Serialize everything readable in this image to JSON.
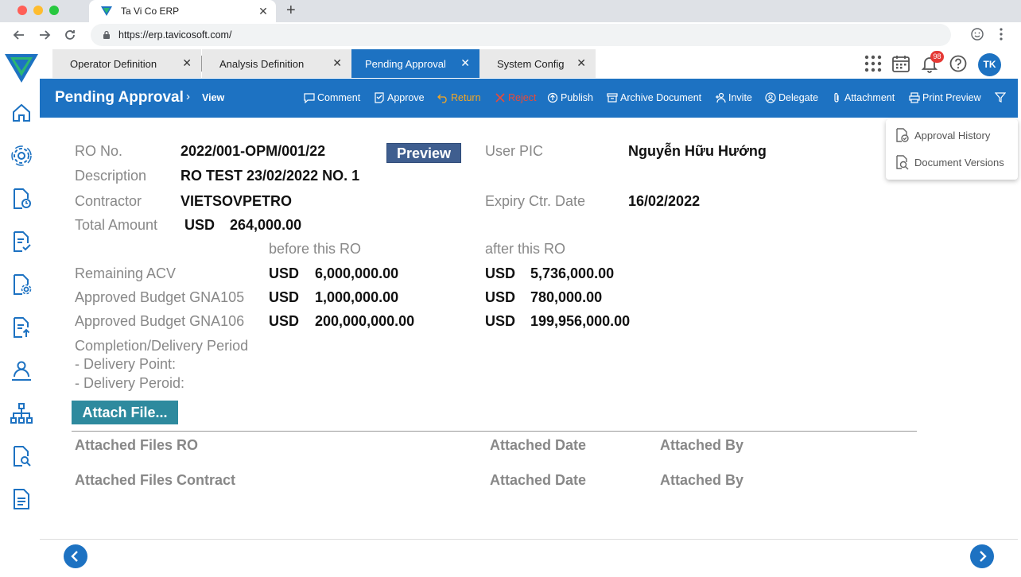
{
  "browser": {
    "tab_title": "Ta Vi Co ERP",
    "url": "https://erp.tavicosoft.com/",
    "new_tab": "+",
    "tab_close": "✕"
  },
  "app_tabs": [
    {
      "label": "Operator Definition",
      "close": "✕"
    },
    {
      "label": "Analysis Definition",
      "close": "✕"
    },
    {
      "label": "Pending Approval",
      "close": "✕"
    },
    {
      "label": "System Config",
      "close": "✕"
    }
  ],
  "header": {
    "notification_count": "98",
    "avatar_initials": "TK"
  },
  "action_bar": {
    "page_title": "Pending Approval",
    "breadcrumb_sep": "›",
    "breadcrumb_current": "View",
    "actions": [
      {
        "label": "Comment",
        "icon": "comment-icon"
      },
      {
        "label": "Approve",
        "icon": "approve-icon"
      },
      {
        "label": "Return",
        "icon": "return-icon"
      },
      {
        "label": "Reject",
        "icon": "reject-icon"
      },
      {
        "label": "Publish",
        "icon": "publish-icon"
      },
      {
        "label": "Archive Document",
        "icon": "archive-icon"
      },
      {
        "label": "Invite",
        "icon": "invite-icon"
      },
      {
        "label": "Delegate",
        "icon": "delegate-icon"
      },
      {
        "label": "Attachment",
        "icon": "paperclip-icon"
      },
      {
        "label": "Print Preview",
        "icon": "print-icon"
      }
    ]
  },
  "dropdown": {
    "items": [
      "Approval History",
      "Document Versions"
    ]
  },
  "form": {
    "ro_no_label": "RO No.",
    "ro_no": "2022/001-OPM/001/22",
    "preview_button": "Preview",
    "user_pic_label": "User PIC",
    "user_pic": "Nguyễn Hữu Hướng",
    "description_label": "Description",
    "description": "RO TEST 23/02/2022 NO. 1",
    "contractor_label": "Contractor",
    "contractor": "VIETSOVPETRO",
    "expiry_label": "Expiry Ctr. Date",
    "expiry": "16/02/2022",
    "total_label": "Total Amount",
    "total_currency": "USD",
    "total_amount": "264,000.00",
    "before_label": "before this RO",
    "after_label": "after this RO",
    "rows": [
      {
        "label": "Remaining ACV",
        "before_cur": "USD",
        "before": "6,000,000.00",
        "after_cur": "USD",
        "after": "5,736,000.00"
      },
      {
        "label": "Approved Budget GNA105",
        "before_cur": "USD",
        "before": "1,000,000.00",
        "after_cur": "USD",
        "after": "780,000.00"
      },
      {
        "label": "Approved Budget GNA106",
        "before_cur": "USD",
        "before": "200,000,000.00",
        "after_cur": "USD",
        "after": "199,956,000.00"
      }
    ],
    "completion_label": "Completion/Delivery Period",
    "delivery_point_label": "- Delivery Point:",
    "delivery_period_label": "- Delivery Peroid:",
    "attach_button": "Attach File...",
    "attached_ro_label": "Attached Files RO",
    "attached_contract_label": "Attached Files Contract",
    "attached_date_label": "Attached Date",
    "attached_by_label": "Attached By"
  },
  "footer": {
    "prev": "‹",
    "next": "›"
  },
  "colors": {
    "primary": "#1d72c2",
    "return": "#f5a623",
    "reject": "#e84a3a",
    "attach_button": "#2e8a9e",
    "preview_button": "#3f5e8f"
  }
}
